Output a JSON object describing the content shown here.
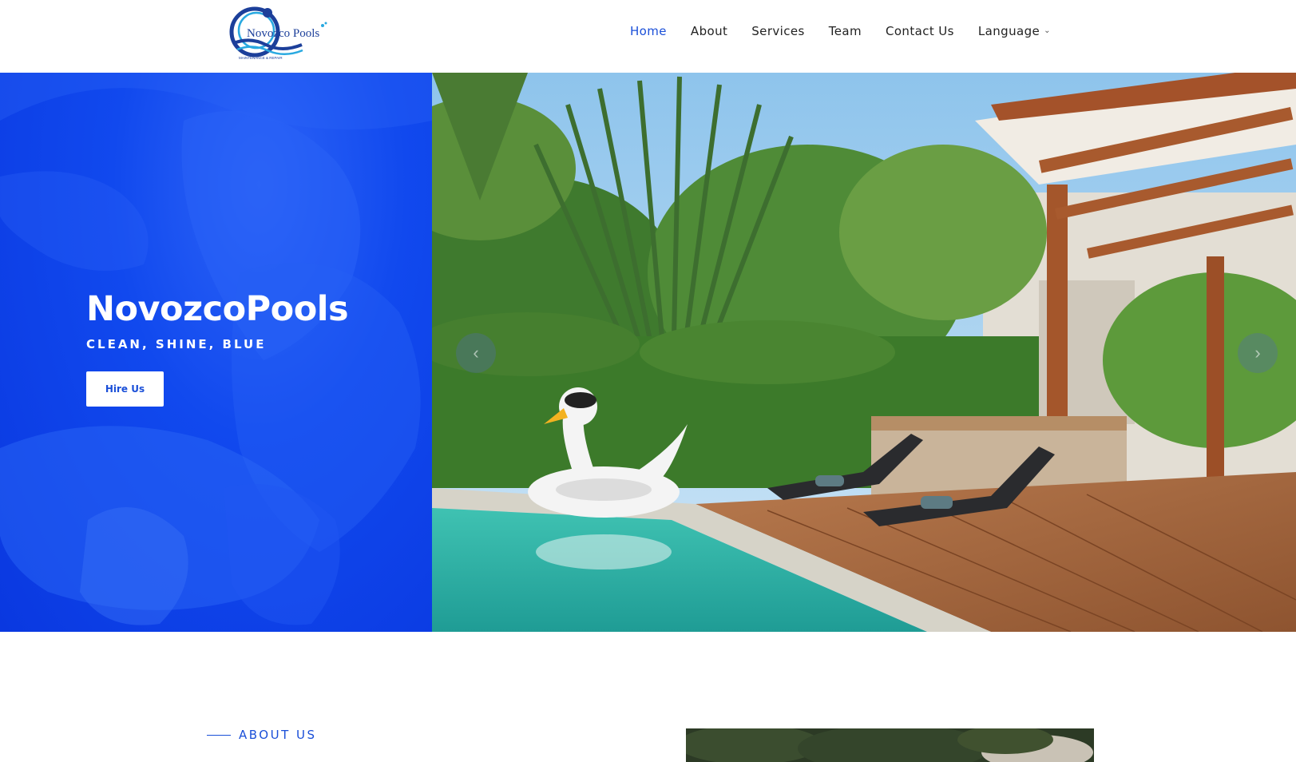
{
  "header": {
    "logo": {
      "brand": "Novozco Pools",
      "tagline": "MAINTENANCE & REPAIR"
    },
    "nav": [
      {
        "label": "Home",
        "active": true
      },
      {
        "label": "About",
        "active": false
      },
      {
        "label": "Services",
        "active": false
      },
      {
        "label": "Team",
        "active": false
      },
      {
        "label": "Contact Us",
        "active": false
      },
      {
        "label": "Language",
        "active": false,
        "dropdown": true
      }
    ]
  },
  "hero": {
    "title": "NovozcoPools",
    "tagline": "CLEAN, SHINE, BLUE",
    "cta_label": "Hire Us",
    "prev_icon": "‹",
    "next_icon": "›"
  },
  "about": {
    "label": "ABOUT US"
  },
  "colors": {
    "accent": "#1a4fd8",
    "hero_blue": "#1149ee",
    "text": "#222222"
  }
}
